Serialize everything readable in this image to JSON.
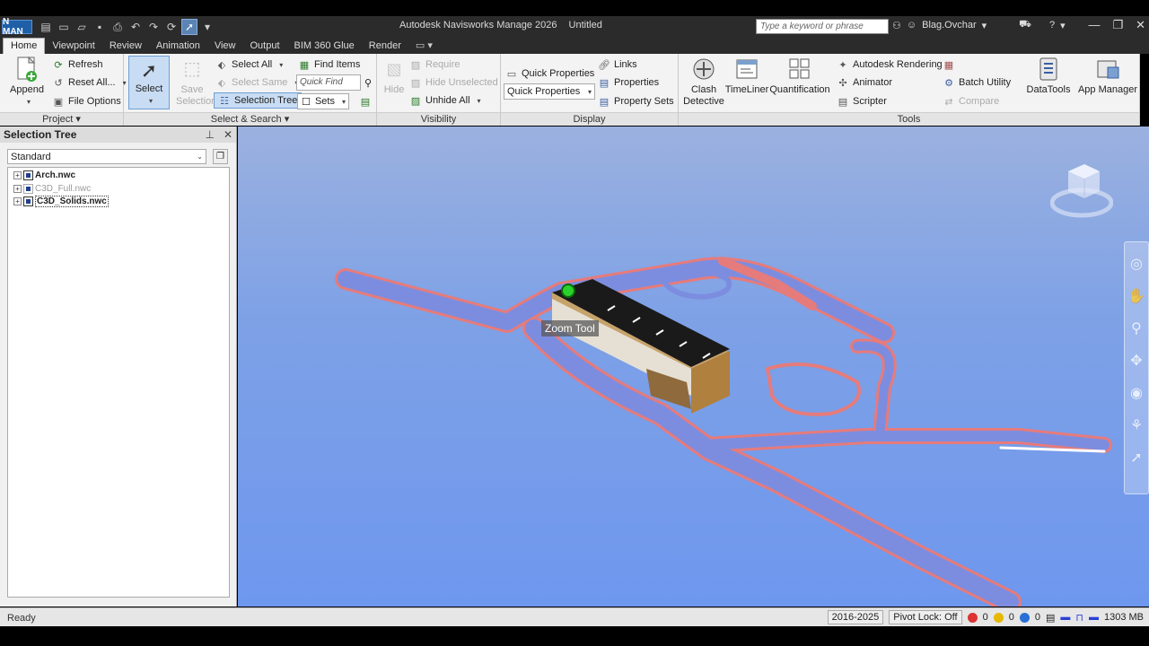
{
  "app": {
    "logo": "N MAN",
    "title": "Autodesk Navisworks Manage 2026",
    "document": "Untitled",
    "search_placeholder": "Type a keyword or phrase",
    "user": "Blag.Ovchar"
  },
  "tabs": [
    "Home",
    "Viewpoint",
    "Review",
    "Animation",
    "View",
    "Output",
    "BIM 360 Glue",
    "Render"
  ],
  "ribbon": {
    "project": {
      "label": "Project",
      "append": "Append",
      "refresh": "Refresh",
      "reset_all": "Reset All...",
      "file_options": "File Options"
    },
    "select_search": {
      "label": "Select & Search",
      "select": "Select",
      "save_selection": "Save Selection",
      "select_all": "Select All",
      "select_same": "Select Same",
      "selection_tree": "Selection Tree",
      "find_items": "Find Items",
      "quick_find_placeholder": "Quick Find",
      "sets": "Sets"
    },
    "visibility": {
      "label": "Visibility",
      "hide": "Hide",
      "require": "Require",
      "hide_unselected": "Hide Unselected",
      "unhide_all": "Unhide All"
    },
    "display": {
      "label": "Display",
      "quick_properties": "Quick Properties",
      "quick_properties_select": "Quick Properties",
      "links": "Links",
      "properties": "Properties",
      "property_sets": "Property Sets"
    },
    "tools": {
      "label": "Tools",
      "clash_detective": "Clash Detective",
      "timeliner": "TimeLiner",
      "quantification": "Quantification",
      "autodesk_rendering": "Autodesk Rendering",
      "animator": "Animator",
      "scripter": "Scripter",
      "batch_utility": "Batch Utility",
      "compare": "Compare",
      "datatools": "DataTools",
      "app_manager": "App Manager"
    }
  },
  "selection_tree": {
    "title": "Selection Tree",
    "mode": "Standard",
    "items": [
      {
        "label": "Arch.nwc"
      },
      {
        "label": "C3D_Full.nwc"
      },
      {
        "label": "C3D_Solids.nwc"
      }
    ]
  },
  "viewport": {
    "tooltip": "Zoom Tool"
  },
  "statusbar": {
    "status": "Ready",
    "years": "2016-2025",
    "pivot_lock": "Pivot Lock: Off",
    "count_errors": "0",
    "count_warnings": "0",
    "count_info": "0",
    "memory": "1303 MB"
  },
  "colors": {
    "accent": "#5b84b5",
    "viewport_bg": "#7ea1e6",
    "road": "#7c8de0",
    "road_edge": "#e67b7b"
  }
}
